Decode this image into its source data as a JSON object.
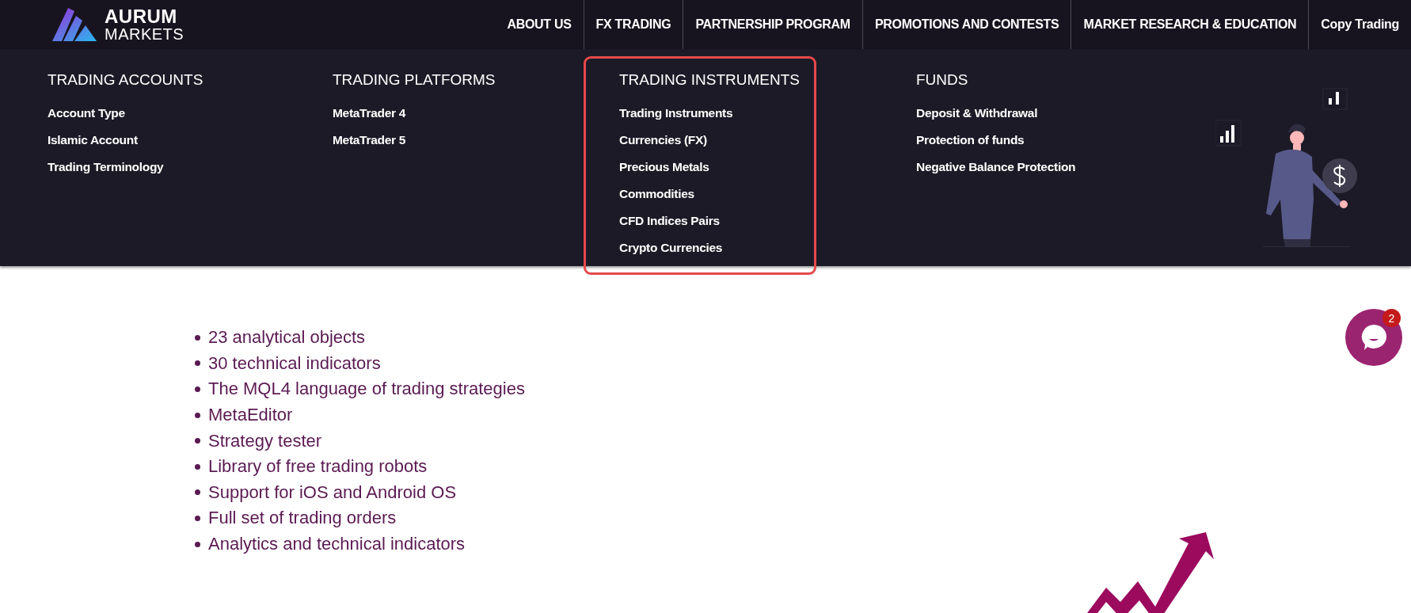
{
  "header": {
    "logo": {
      "line_1": "AURUM",
      "line_2": "MARKETS"
    },
    "nav": [
      {
        "label": "ABOUT US",
        "selected": false
      },
      {
        "label": "FX TRADING",
        "selected": false
      },
      {
        "label": "PARTNERSHIP PROGRAM",
        "selected": false
      },
      {
        "label": "PROMOTIONS AND CONTESTS",
        "selected": false
      },
      {
        "label": "MARKET RESEARCH & EDUCATION",
        "selected": false
      },
      {
        "label": "Copy Trading",
        "selected": false
      }
    ]
  },
  "mega_menu": {
    "columns": [
      {
        "heading": "TRADING ACCOUNTS",
        "highlighted": false,
        "items": [
          "Account Type",
          "Islamic Account",
          "Trading Terminology"
        ]
      },
      {
        "heading": "TRADING PLATFORMS",
        "highlighted": false,
        "items": [
          "MetaTrader 4",
          "MetaTrader 5"
        ]
      },
      {
        "heading": "TRADING INSTRUMENTS",
        "highlighted": true,
        "items": [
          "Trading Instruments",
          "Currencies (FX)",
          "Precious Metals",
          "Commodities",
          "CFD Indices Pairs",
          "Crypto Currencies"
        ]
      },
      {
        "heading": "FUNDS",
        "highlighted": false,
        "items": [
          "Deposit & Withdrawal",
          "Protection of funds",
          "Negative Balance Protection"
        ]
      }
    ]
  },
  "features": [
    "23 analytical objects",
    "30 technical indicators",
    "The MQL4 language of trading strategies",
    "MetaEditor",
    "Strategy tester",
    "Library of free trading robots",
    "Support for iOS and Android OS",
    "Full set of trading orders",
    "Analytics and technical indicators"
  ],
  "chat": {
    "badge": "2"
  }
}
